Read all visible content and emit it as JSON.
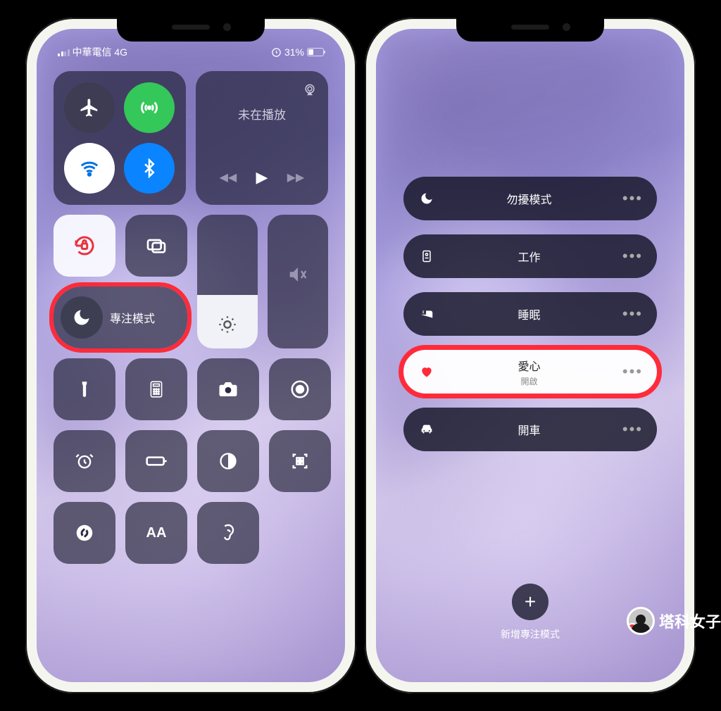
{
  "status": {
    "carrier": "中華電信 4G",
    "battery_pct": "31%"
  },
  "media": {
    "not_playing": "未在播放"
  },
  "focus_button_label": "專注模式",
  "focus_modes": {
    "dnd": "勿擾模式",
    "work": "工作",
    "sleep": "睡眠",
    "love": "愛心",
    "love_sub": "開啟",
    "driving": "開車"
  },
  "add_focus_label": "新增專注模式",
  "watermark": "塔科女子",
  "icons": {
    "airplane": "airplane-icon",
    "cellular": "cellular-icon",
    "wifi": "wifi-icon",
    "bluetooth": "bluetooth-icon",
    "lock_rotation": "lock-rotation-icon",
    "screen_mirror": "screen-mirror-icon",
    "moon": "moon-icon",
    "sun": "brightness-icon",
    "mute": "mute-icon",
    "flashlight": "flashlight-icon",
    "calculator": "calculator-icon",
    "camera": "camera-icon",
    "record": "screen-record-icon",
    "alarm": "alarm-icon",
    "low_power": "low-power-icon",
    "dark_mode": "dark-mode-icon",
    "qr": "qr-scan-icon",
    "shazam": "shazam-icon",
    "text_size": "text-size-icon",
    "hearing": "hearing-icon",
    "badge": "badge-icon",
    "bed": "bed-icon",
    "heart": "heart-icon",
    "car": "car-icon",
    "plus": "plus-icon"
  }
}
